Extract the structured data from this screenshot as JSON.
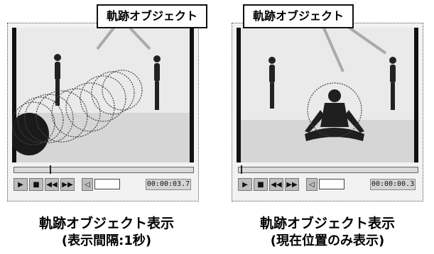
{
  "panels": [
    {
      "callout_label": "軌跡オブジェクト",
      "timecode": "00:00:03.7",
      "seek_progress": 0.2,
      "caption_line1": "軌跡オブジェクト表示",
      "caption_line2": "(表示間隔:1秒)"
    },
    {
      "callout_label": "軌跡オブジェクト",
      "timecode": "00:00:00.3",
      "seek_progress": 0.01,
      "caption_line1": "軌跡オブジェクト表示",
      "caption_line2": "(現在位置のみ表示)"
    }
  ],
  "icons": {
    "play": "play-icon",
    "stop": "stop-icon",
    "rewind": "rewind-icon",
    "fast_forward": "fast-forward-icon",
    "volume": "speaker-icon"
  },
  "colors": {
    "frame_dark": "#111111",
    "trajectory": "#555555",
    "arrow": "#bbbbbb",
    "control_bg": "#bdbdbd"
  }
}
